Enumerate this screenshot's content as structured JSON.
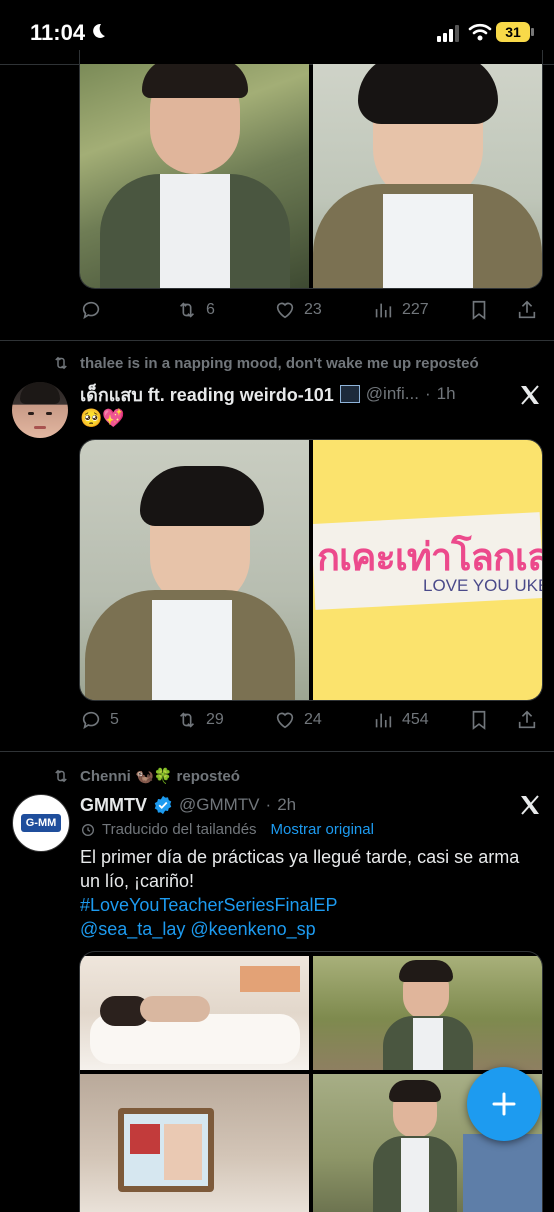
{
  "status_bar": {
    "time": "11:04",
    "battery": "31"
  },
  "tweet1": {
    "actions": {
      "reply": "",
      "retweets": "6",
      "likes": "23",
      "views": "227"
    }
  },
  "tweet2": {
    "reposted_by": "thalee is in a napping mood, don't wake me up reposteó",
    "display_name": "เด็กแสบ ft. reading weirdo-101",
    "handle": "@infi...",
    "time": "1h",
    "text": "🥺💖",
    "media_text": {
      "thai": "กเคะเท่าโลกเล",
      "subtitle": "LOVE YOU UKE"
    },
    "actions": {
      "reply": "5",
      "retweets": "29",
      "likes": "24",
      "views": "454"
    }
  },
  "tweet3": {
    "reposted_by": "Chenni 🦦🍀 reposteó",
    "display_name": "GMMTV",
    "handle": "@GMMTV",
    "time": "2h",
    "translated_note": "Traducido del tailandés",
    "show_original": "Mostrar original",
    "text": "El primer día de prácticas ya llegué tarde, casi se arma un lío, ¡cariño!",
    "hashtag": "#LoveYouTeacherSeriesFinalEP",
    "mentions": "@sea_ta_lay @keenkeno_sp",
    "avatar_logo": "G-MM"
  },
  "colors": {
    "accent": "#1d9bf0",
    "muted": "#71767b",
    "background": "#000000",
    "text": "#e7e9ea"
  },
  "icons": [
    "moon-icon",
    "signal-icon",
    "wifi-icon",
    "reply-icon",
    "retweet-icon",
    "like-icon",
    "views-icon",
    "bookmark-icon",
    "share-icon",
    "x-logo-icon",
    "verified-icon",
    "translate-icon",
    "plus-icon"
  ]
}
